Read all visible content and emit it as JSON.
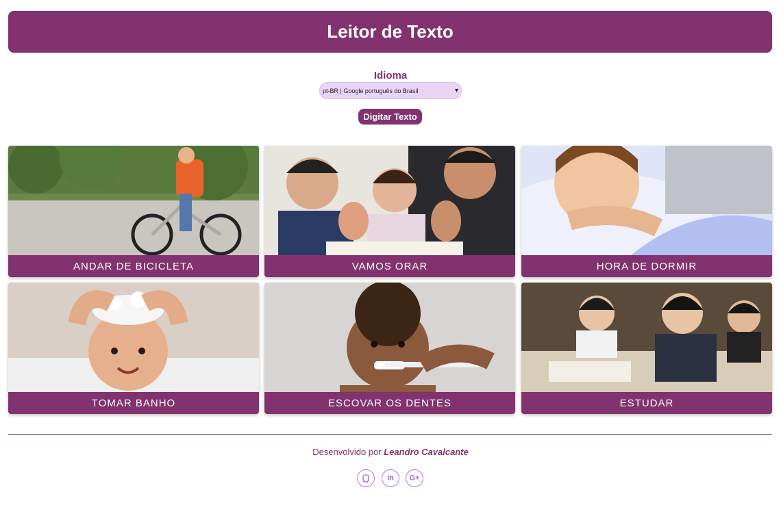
{
  "header": {
    "title": "Leitor de Texto"
  },
  "language": {
    "label": "Idioma",
    "selected": "pt-BR | Google português do Brasil"
  },
  "type_button": "Digitar Texto",
  "cards": [
    {
      "label": "ANDAR DE BICICLETA"
    },
    {
      "label": "VAMOS ORAR"
    },
    {
      "label": "HORA DE DORMIR"
    },
    {
      "label": "TOMAR BANHO"
    },
    {
      "label": "ESCOVAR OS DENTES"
    },
    {
      "label": "ESTUDAR"
    }
  ],
  "footer": {
    "prefix": "Desenvolvido por",
    "author": "Leandro Cavalcante",
    "social": [
      {
        "icon": "github-icon",
        "glyph": "⌂"
      },
      {
        "icon": "linkedin-icon",
        "glyph": "in"
      },
      {
        "icon": "google-plus-icon",
        "glyph": "G+"
      }
    ]
  },
  "colors": {
    "primary": "#82326e",
    "select_bg": "#e9d3f7",
    "social": "#b872e6"
  }
}
